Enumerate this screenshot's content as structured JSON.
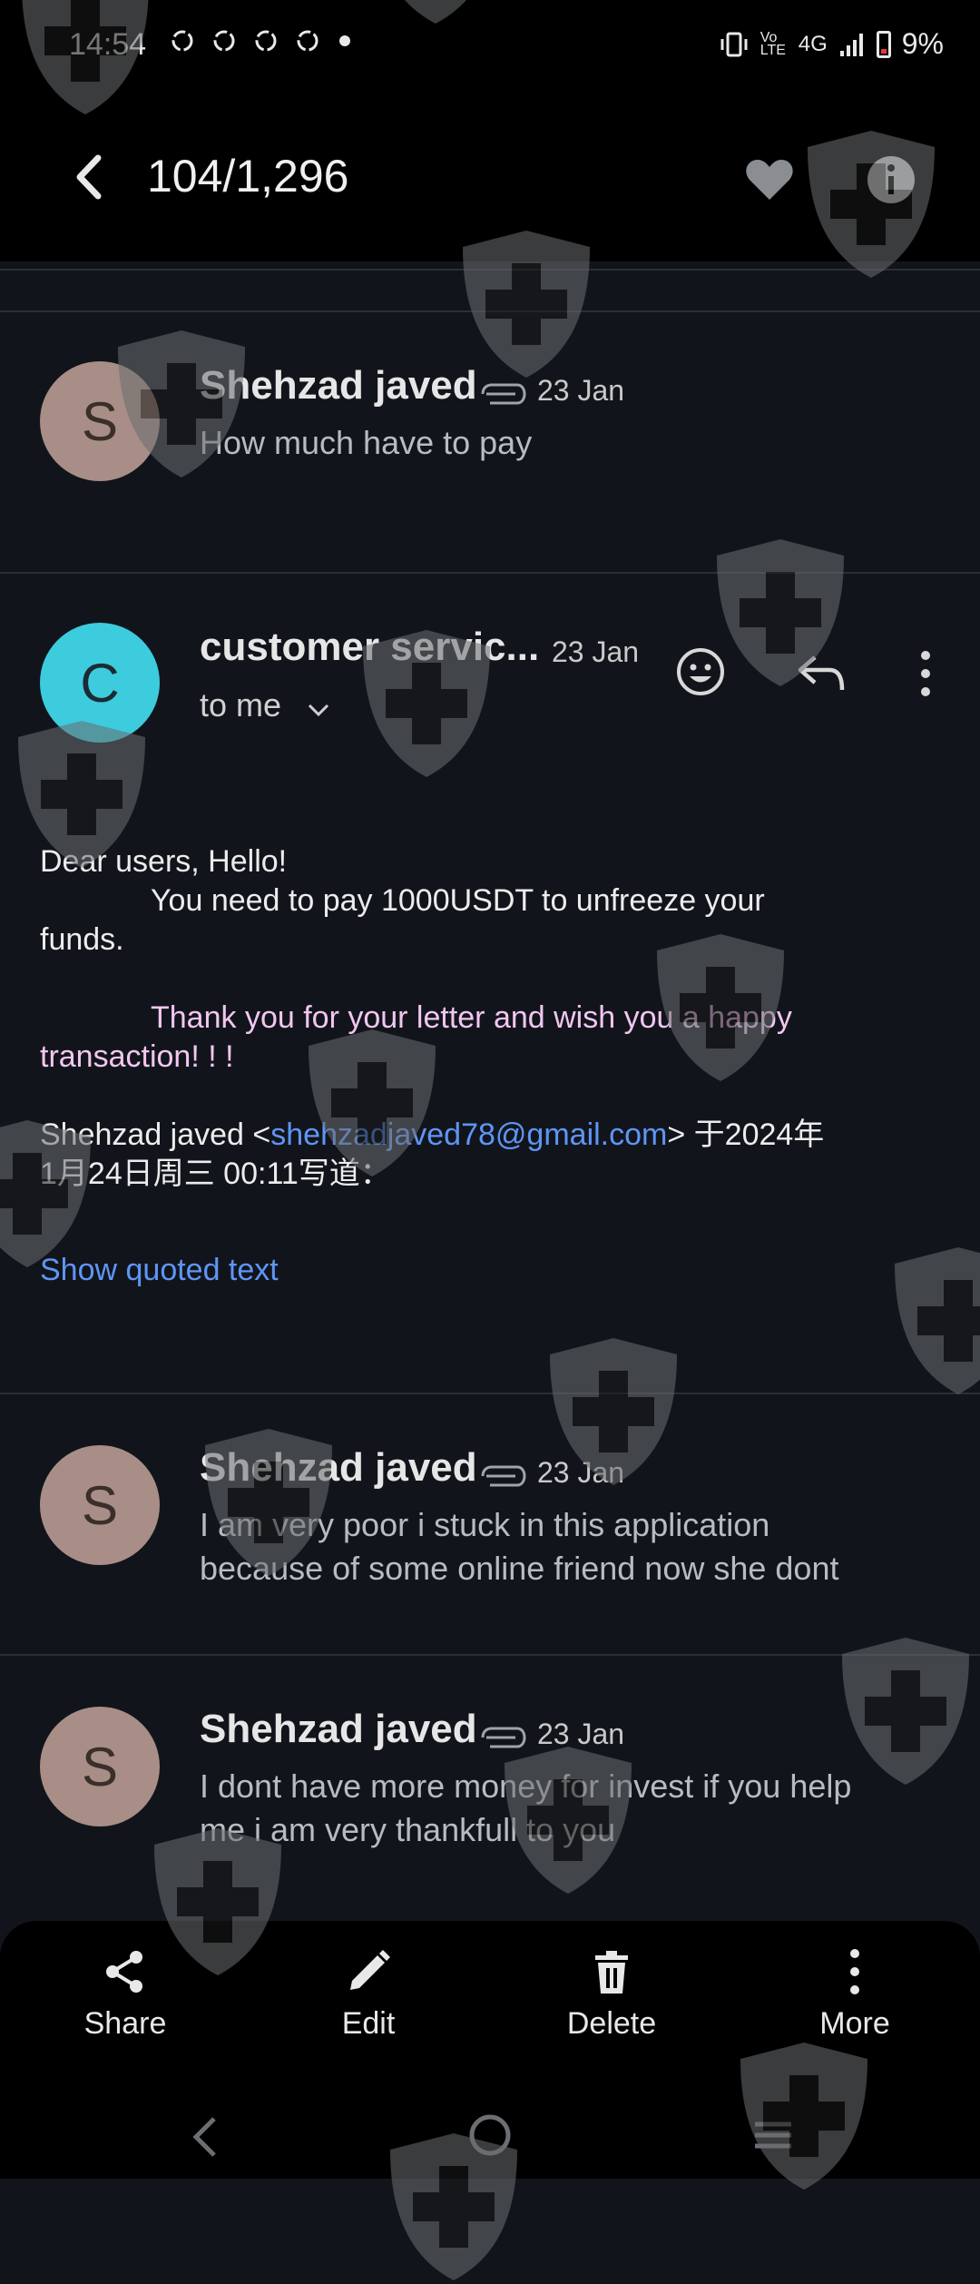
{
  "status_bar": {
    "time": "14:54",
    "network": "4G",
    "volte": "Vo LTE",
    "battery": "9%",
    "notification_icons": [
      "sync-icon",
      "sync-icon",
      "sync-icon",
      "sync-icon",
      "dot-icon"
    ]
  },
  "header": {
    "title": "104/1,296"
  },
  "messages": [
    {
      "sender": "Shehzad javed",
      "avatar_letter": "S",
      "date": "23 Jan",
      "snippet": "How much have to pay",
      "has_attachment": true
    },
    {
      "sender": "customer servic...",
      "avatar_letter": "C",
      "date": "23 Jan",
      "recipient": "to me",
      "body": {
        "greeting": "Dear users, Hello!",
        "line_indent": "You need to pay 1000USDT to unfreeze your",
        "line_cont": "funds.",
        "thanks_indent": "Thank you for your letter and wish you a happy",
        "thanks_cont": "transaction! ! !",
        "quote_prefix": "Shehzad javed <",
        "quote_email": "shehzadjaved78@gmail.com",
        "quote_suffix": "> 于2024年",
        "quote_line2": "1月24日周三 00:11写道："
      },
      "show_quoted": "Show quoted text"
    },
    {
      "sender": "Shehzad javed",
      "avatar_letter": "S",
      "date": "23 Jan",
      "snippet_line1": "I am very poor i stuck in this application",
      "snippet_line2": "because of some online friend now she dont",
      "has_attachment": true
    },
    {
      "sender": "Shehzad javed",
      "avatar_letter": "S",
      "date": "23 Jan",
      "snippet_line1": "I dont have more money for invest if you help",
      "snippet_line2": "me i am very thankfull to you",
      "has_attachment": true
    }
  ],
  "bottom_actions": [
    {
      "label": "Share",
      "icon": "share-icon"
    },
    {
      "label": "Edit",
      "icon": "pencil-icon"
    },
    {
      "label": "Delete",
      "icon": "trash-icon"
    },
    {
      "label": "More",
      "icon": "more-vert-icon"
    }
  ],
  "colors": {
    "background": "#11151b",
    "header": "#000000",
    "avatar_s": "#a88e86",
    "avatar_c": "#3dcbde",
    "link": "#5f95f5",
    "pink_text": "#f2c6f0"
  }
}
